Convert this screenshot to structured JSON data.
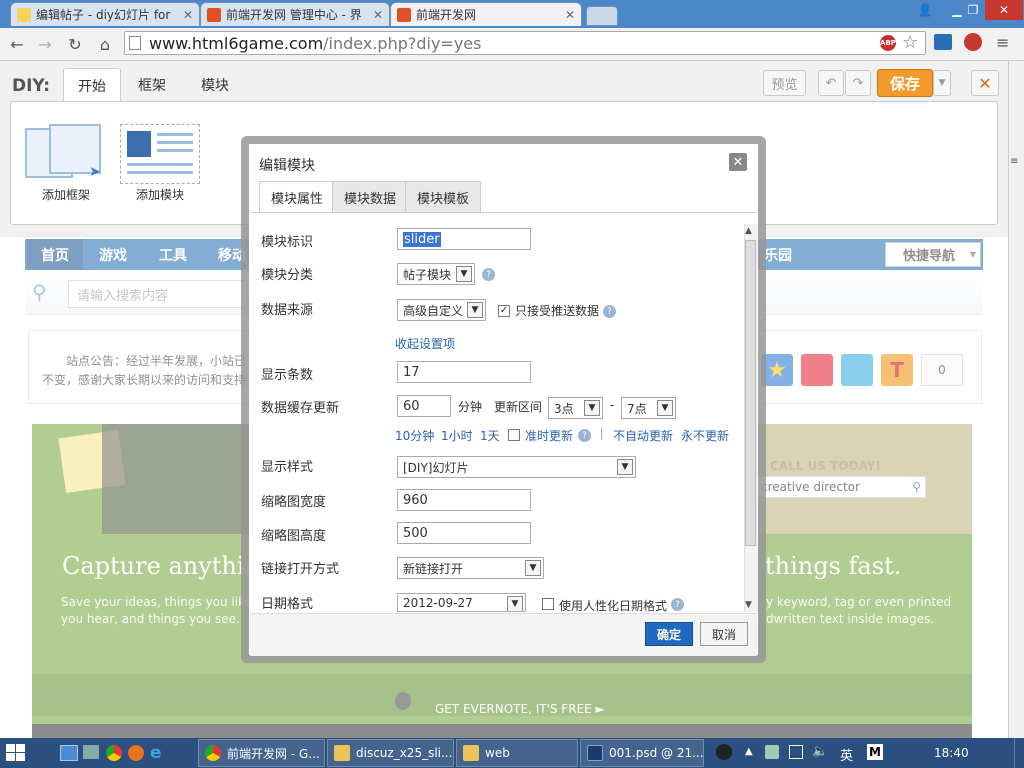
{
  "browser": {
    "tabs": [
      {
        "title": "编辑帖子 - diy幻灯片 for",
        "icon": "note-icon"
      },
      {
        "title": "前端开发网 管理中心 - 界",
        "icon": "html5-icon"
      },
      {
        "title": "前端开发网",
        "icon": "html5-icon",
        "active": true
      }
    ],
    "url_host": "www.html6game.com",
    "url_path": "/index.php?diy=yes"
  },
  "diy": {
    "label": "DIY:",
    "tabs": [
      "开始",
      "框架",
      "模块"
    ],
    "preview": "预览",
    "save": "保存",
    "items": [
      {
        "label": "添加框架",
        "icon": "add-frame-icon"
      },
      {
        "label": "添加模块",
        "icon": "add-module-icon"
      }
    ]
  },
  "site": {
    "nav": [
      "首页",
      "游戏",
      "工具",
      "移动"
    ],
    "nav_right": "乐园",
    "quicknav": "快捷导航",
    "search_placeholder": "请输入搜索内容",
    "notice_line1": "站点公告：经过半年发展，小站已",
    "notice_line2": "不变，感谢大家长期以来的访问和支持",
    "share_count": "0",
    "banner": {
      "headline_left": "Capture anything",
      "headline_right": "things fast.",
      "sub_left1": "Save your ideas, things you like,",
      "sub_left2": "you hear, and things you see.",
      "sub_right1": "y keyword, tag or even printed",
      "sub_right2": "dwritten text inside images.",
      "search_text": "creative director",
      "call": "CALL US TODAY!",
      "footer": "GET EVERNOTE, IT'S FREE ►"
    }
  },
  "dialog": {
    "title": "编辑模块",
    "tabs": [
      "模块属性",
      "模块数据",
      "模块模板"
    ],
    "fields": {
      "module_id_label": "模块标识",
      "module_id_value": "slider",
      "category_label": "模块分类",
      "category_value": "帖子模块",
      "source_label": "数据来源",
      "source_value": "高级自定义",
      "push_label": "只接受推送数据",
      "collapse_link": "收起设置项",
      "count_label": "显示条数",
      "count_value": "17",
      "cache_label": "数据缓存更新",
      "cache_value": "60",
      "cache_unit": "分钟",
      "range_label": "更新区间",
      "range_from": "3点",
      "range_sep": "-",
      "range_to": "7点",
      "quick_10": "10分钟",
      "quick_1h": "1小时",
      "quick_1d": "1天",
      "ontime": "准时更新",
      "no_auto": "不自动更新",
      "never": "永不更新",
      "style_label": "显示样式",
      "style_value": "[DIY]幻灯片",
      "thumb_w_label": "缩略图宽度",
      "thumb_w_value": "960",
      "thumb_h_label": "缩略图高度",
      "thumb_h_value": "500",
      "link_label": "链接打开方式",
      "link_value": "新链接打开",
      "date_label": "日期格式",
      "date_value": "2012-09-27",
      "humanize_label": "使用人性化日期格式"
    },
    "ok": "确定",
    "cancel": "取消"
  },
  "taskbar": {
    "items": [
      {
        "label": "前端开发网 - G...",
        "icon": "chrome-icon"
      },
      {
        "label": "discuz_x25_sli...",
        "icon": "folder-icon"
      },
      {
        "label": "web",
        "icon": "folder-icon"
      },
      {
        "label": "001.psd @ 21...",
        "icon": "photoshop-icon"
      }
    ],
    "ime": "英",
    "clock": "18:40"
  },
  "colors": {
    "accent": "#1f6ab4",
    "save": "#f39a2b",
    "ok": "#2068c0",
    "banner": "#74a43a"
  }
}
